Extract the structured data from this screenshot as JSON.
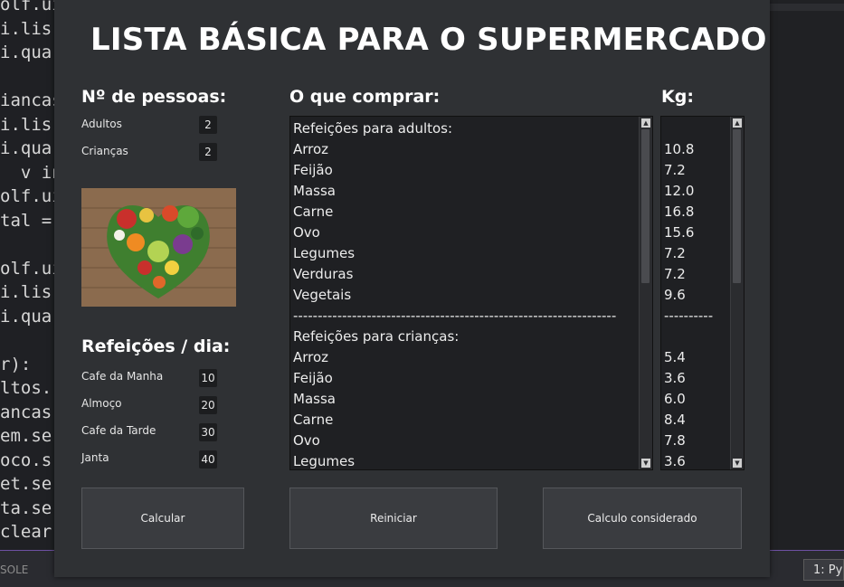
{
  "editor": {
    "code_lines": [
      "olf.ui",
      "i.lis",
      "i.qua",
      "",
      "iancas",
      "i.lis",
      "i.qua",
      "  v in",
      "olf.ui",
      "tal =",
      "",
      "olf.ui",
      "i.lis",
      "i.qua",
      "",
      "r):",
      "ltos.",
      "ancas",
      "em.se",
      "oco.s",
      "et.se",
      "ta.se",
      "clear"
    ],
    "status_left": "SOLE",
    "status_right": "1: Py"
  },
  "app": {
    "title": "LISTA BÁSICA PARA O SUPERMERCADO",
    "people": {
      "heading": "Nº de pessoas:",
      "adults_label": "Adultos",
      "adults_value": "2",
      "children_label": "Crianças",
      "children_value": "2"
    },
    "meals": {
      "heading": "Refeições / dia:",
      "breakfast_label": "Cafe da Manha",
      "breakfast_value": "10",
      "lunch_label": "Almoço",
      "lunch_value": "20",
      "afternoon_label": "Cafe da Tarde",
      "afternoon_value": "30",
      "dinner_label": "Janta",
      "dinner_value": "40"
    },
    "shopping": {
      "heading": "O que comprar:",
      "items": [
        "Refeições para adultos:",
        "Arroz",
        "Feijão",
        "Massa",
        "Carne",
        "Ovo",
        "Legumes",
        "Verduras",
        "Vegetais",
        "------------------------------------------------------------------",
        "Refeições para crianças:",
        "Arroz",
        "Feijão",
        "Massa",
        "Carne",
        "Ovo",
        "Legumes"
      ]
    },
    "kg": {
      "heading": "Kg:",
      "items": [
        "",
        "10.8",
        "7.2",
        "12.0",
        "16.8",
        "15.6",
        "7.2",
        "7.2",
        "9.6",
        "----------",
        "",
        "5.4",
        "3.6",
        "6.0",
        "8.4",
        "7.8",
        "3.6"
      ]
    },
    "buttons": {
      "calculate": "Calcular",
      "reset": "Reiniciar",
      "considered": "Calculo considerado"
    }
  }
}
